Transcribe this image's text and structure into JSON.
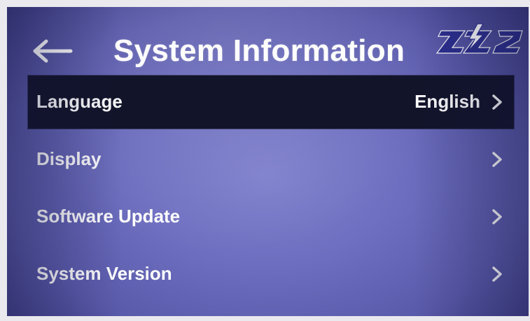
{
  "header": {
    "back_icon": "arrow-left-icon",
    "title": "System Information",
    "logo_text": "ZZ2"
  },
  "menu": {
    "items": [
      {
        "label": "Language",
        "value": "English",
        "icon": "chevron-right-icon",
        "selected": true
      },
      {
        "label": "Display",
        "value": "",
        "icon": "chevron-right-icon",
        "selected": false
      },
      {
        "label": "Software Update",
        "value": "",
        "icon": "chevron-right-icon",
        "selected": false
      },
      {
        "label": "System Version",
        "value": "",
        "icon": "chevron-right-icon",
        "selected": false
      }
    ]
  },
  "colors": {
    "background": "#6e6fc0",
    "selected_row": "#12142a",
    "text": "#ffffff",
    "logo_blue": "#2c2f8f"
  }
}
